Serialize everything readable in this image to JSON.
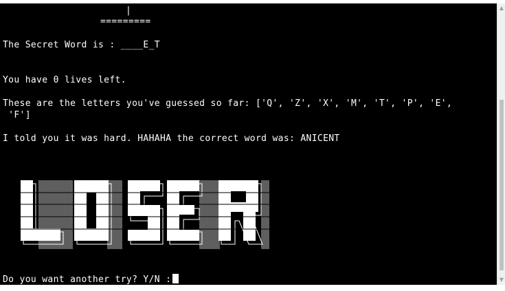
{
  "terminal": {
    "background": "#000000",
    "foreground": "#ffffff",
    "gallows_pole": "|",
    "gallows_base": "=========",
    "secret_word_line": "The Secret Word is : ____E_T",
    "lives_line": "You have 0 lives left.",
    "guessed_line_1": "These are the letters you've guessed so far: ['Q', 'Z', 'X', 'M', 'T', 'P', 'E',",
    "guessed_line_2": " 'F']",
    "result_line": "I told you it was hard. HAHAHA the correct word was: ANICENT",
    "banner_text": "LOSER",
    "prompt_line": "Do you want another try? Y/N :"
  },
  "scrollbar": {
    "up_icon": "triangle-up-icon",
    "down_icon": "triangle-down-icon"
  }
}
